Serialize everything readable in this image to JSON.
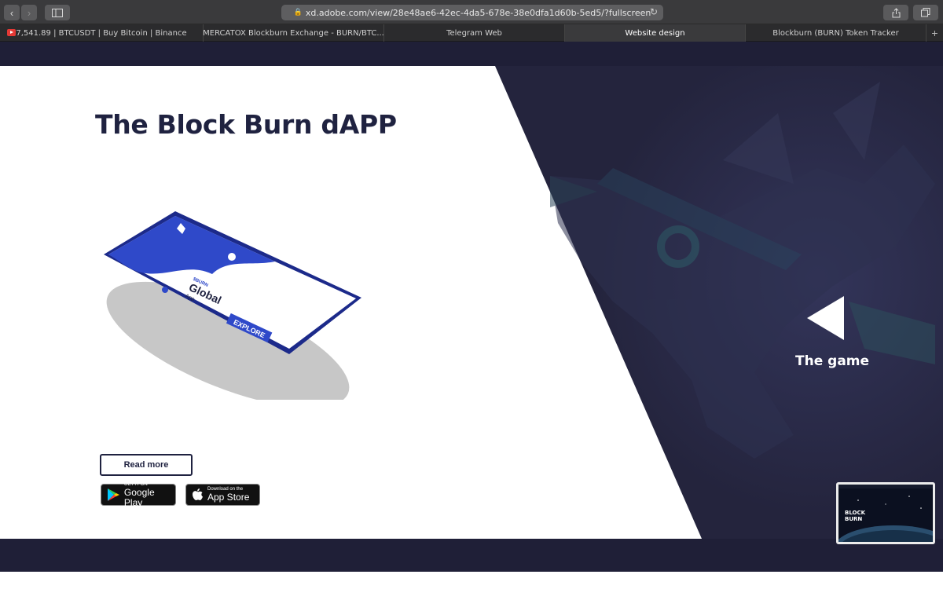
{
  "browser": {
    "url": "xd.adobe.com/view/28e48ae6-42ec-4da5-678e-38e0dfa1d60b-5ed5/?fullscreen",
    "tabs": [
      {
        "label": "7,541.89 | BTCUSDT | Buy Bitcoin | Binance",
        "active": false,
        "icon": "youtube-icon"
      },
      {
        "label": "MERCATOX Blockburn Exchange - BURN/BTC...",
        "active": false
      },
      {
        "label": "Telegram Web",
        "active": false
      },
      {
        "label": "Website design",
        "active": true
      },
      {
        "label": "Blockburn (BURN) Token Tracker",
        "active": false
      }
    ],
    "new_tab": "+"
  },
  "hero": {
    "title": "The Block Burn dAPP",
    "read_more": "Read more",
    "google_play": {
      "small": "GET IT ON",
      "big": "Google Play"
    },
    "app_store": {
      "small": "Download on the",
      "big": "App Store"
    },
    "phone_screen": {
      "brand": "$BURN",
      "line1": "Global",
      "line2": "App",
      "button": "EXPLORE"
    }
  },
  "game": {
    "label": "The game"
  },
  "thumbnail": {
    "line1": "BLOCK",
    "line2": "BURN"
  },
  "colors": {
    "navy": "#1f2240",
    "dark_panel": "#25253f",
    "phone_blue": "#2f49c9"
  }
}
